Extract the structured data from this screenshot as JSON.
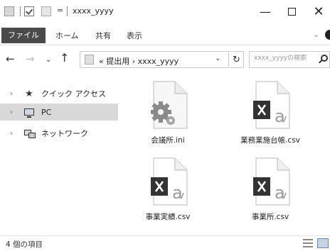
{
  "window": {
    "title": "xxxx_yyyy",
    "qat_separator": "|",
    "qat_dropdown": "=",
    "minimize_glyph": "—",
    "close_glyph": "✕"
  },
  "ribbon": {
    "tabs": [
      "ファイル",
      "ホーム",
      "共有",
      "表示"
    ],
    "expand_glyph": "⌄"
  },
  "nav": {
    "back_glyph": "←",
    "forward_glyph": "→",
    "recent_glyph": "⌄",
    "up_glyph": "↑",
    "path": "« 提出用 › xxxx_yyyy",
    "path_dropdown_glyph": "⌄",
    "refresh_glyph": "↻",
    "search_placeholder": "xxxx_yyyyの検索"
  },
  "sidebar": {
    "items": [
      {
        "label": "クイック アクセス",
        "icon": "star-icon",
        "selected": false
      },
      {
        "label": "PC",
        "icon": "pc-icon",
        "selected": true
      },
      {
        "label": "ネットワーク",
        "icon": "network-icon",
        "selected": false
      }
    ],
    "chevron_glyph": "›"
  },
  "files": [
    {
      "name": "会議所.ini",
      "icon": "settings-file-icon"
    },
    {
      "name": "業務業施台帳.csv",
      "icon": "excel-csv-icon"
    },
    {
      "name": "事業実績.csv",
      "icon": "excel-csv-icon"
    },
    {
      "name": "事業所.csv",
      "icon": "excel-csv-icon"
    }
  ],
  "status": {
    "item_count": "4 個の項目"
  },
  "colors": {
    "file_tab_bg": "#4a4a4a",
    "excel_badge": "#333333",
    "selected_item": "#d9d9d9"
  }
}
